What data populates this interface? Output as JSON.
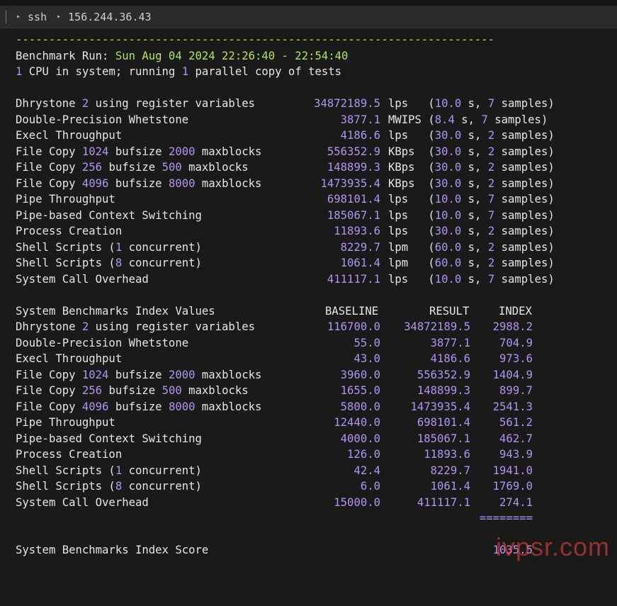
{
  "tab": {
    "segments": [
      "ssh",
      "156.244.36.43"
    ]
  },
  "header": {
    "dashes": "------------------------------------------------------------------------",
    "run_label": "Benchmark Run: ",
    "run_value": "Sun Aug 04 2024 22:26:40 - 22:54:40",
    "cpu_count": "1",
    "cpu_mid": " CPU in system; running ",
    "copies": "1",
    "cpu_end": " parallel copy of tests"
  },
  "results": [
    {
      "name": [
        "Dhrystone ",
        "2",
        " using register variables"
      ],
      "value": "34872189.5",
      "unit": "lps  ",
      "time": "10.0",
      "samples": "7"
    },
    {
      "name": [
        "Double-Precision Whetstone",
        "",
        ""
      ],
      "value": "3877.1",
      "unit": "MWIPS",
      "time": "8.4",
      "samples": "7"
    },
    {
      "name": [
        "Execl Throughput",
        "",
        ""
      ],
      "value": "4186.6",
      "unit": "lps  ",
      "time": "30.0",
      "samples": "2"
    },
    {
      "name": [
        "File Copy ",
        "1024",
        " bufsize ",
        "2000",
        " maxblocks"
      ],
      "value": "556352.9",
      "unit": "KBps ",
      "time": "30.0",
      "samples": "2"
    },
    {
      "name": [
        "File Copy ",
        "256",
        " bufsize ",
        "500",
        " maxblocks"
      ],
      "value": "148899.3",
      "unit": "KBps ",
      "time": "30.0",
      "samples": "2"
    },
    {
      "name": [
        "File Copy ",
        "4096",
        " bufsize ",
        "8000",
        " maxblocks"
      ],
      "value": "1473935.4",
      "unit": "KBps ",
      "time": "30.0",
      "samples": "2"
    },
    {
      "name": [
        "Pipe Throughput",
        "",
        ""
      ],
      "value": "698101.4",
      "unit": "lps  ",
      "time": "10.0",
      "samples": "7"
    },
    {
      "name": [
        "Pipe-based Context Switching",
        "",
        ""
      ],
      "value": "185067.1",
      "unit": "lps  ",
      "time": "10.0",
      "samples": "7"
    },
    {
      "name": [
        "Process Creation",
        "",
        ""
      ],
      "value": "11893.6",
      "unit": "lps  ",
      "time": "30.0",
      "samples": "2"
    },
    {
      "name": [
        "Shell Scripts (",
        "1",
        " concurrent)"
      ],
      "value": "8229.7",
      "unit": "lpm  ",
      "time": "60.0",
      "samples": "2"
    },
    {
      "name": [
        "Shell Scripts (",
        "8",
        " concurrent)"
      ],
      "value": "1061.4",
      "unit": "lpm  ",
      "time": "60.0",
      "samples": "2"
    },
    {
      "name": [
        "System Call Overhead",
        "",
        ""
      ],
      "value": "411117.1",
      "unit": "lps  ",
      "time": "10.0",
      "samples": "7"
    }
  ],
  "index": {
    "title": "System Benchmarks Index Values",
    "col_baseline": "BASELINE",
    "col_result": "RESULT",
    "col_index": "INDEX",
    "rows": [
      {
        "name": [
          "Dhrystone ",
          "2",
          " using register variables"
        ],
        "baseline": "116700.0",
        "result": "34872189.5",
        "index": "2988.2"
      },
      {
        "name": [
          "Double-Precision Whetstone",
          "",
          ""
        ],
        "baseline": "55.0",
        "result": "3877.1",
        "index": "704.9"
      },
      {
        "name": [
          "Execl Throughput",
          "",
          ""
        ],
        "baseline": "43.0",
        "result": "4186.6",
        "index": "973.6"
      },
      {
        "name": [
          "File Copy ",
          "1024",
          " bufsize ",
          "2000",
          " maxblocks"
        ],
        "baseline": "3960.0",
        "result": "556352.9",
        "index": "1404.9"
      },
      {
        "name": [
          "File Copy ",
          "256",
          " bufsize ",
          "500",
          " maxblocks"
        ],
        "baseline": "1655.0",
        "result": "148899.3",
        "index": "899.7"
      },
      {
        "name": [
          "File Copy ",
          "4096",
          " bufsize ",
          "8000",
          " maxblocks"
        ],
        "baseline": "5800.0",
        "result": "1473935.4",
        "index": "2541.3"
      },
      {
        "name": [
          "Pipe Throughput",
          "",
          ""
        ],
        "baseline": "12440.0",
        "result": "698101.4",
        "index": "561.2"
      },
      {
        "name": [
          "Pipe-based Context Switching",
          "",
          ""
        ],
        "baseline": "4000.0",
        "result": "185067.1",
        "index": "462.7"
      },
      {
        "name": [
          "Process Creation",
          "",
          ""
        ],
        "baseline": "126.0",
        "result": "11893.6",
        "index": "943.9"
      },
      {
        "name": [
          "Shell Scripts (",
          "1",
          " concurrent)"
        ],
        "baseline": "42.4",
        "result": "8229.7",
        "index": "1941.0"
      },
      {
        "name": [
          "Shell Scripts (",
          "8",
          " concurrent)"
        ],
        "baseline": "6.0",
        "result": "1061.4",
        "index": "1769.0"
      },
      {
        "name": [
          "System Call Overhead",
          "",
          ""
        ],
        "baseline": "15000.0",
        "result": "411117.1",
        "index": "274.1"
      }
    ],
    "separator": "========",
    "score_label": "System Benchmarks Index Score",
    "score_value": "1035.5"
  },
  "watermark": "ivpsr.com",
  "colors": {
    "green": "#b3e35e",
    "purple": "#b294f0",
    "text": "#e6e6e6",
    "background": "#1a1a1a"
  }
}
